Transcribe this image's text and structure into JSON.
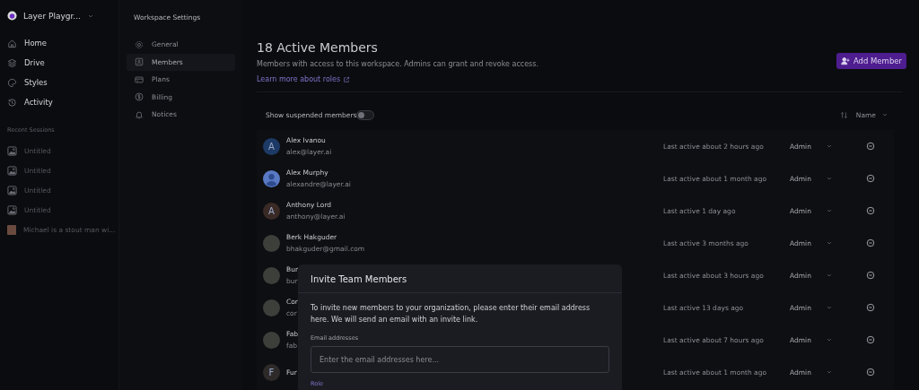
{
  "workspace": {
    "name": "Layer Playgr..."
  },
  "nav": [
    {
      "label": "Home"
    },
    {
      "label": "Drive"
    },
    {
      "label": "Styles"
    },
    {
      "label": "Activity"
    }
  ],
  "recent_sessions": {
    "title": "Recent Sessions",
    "items": [
      {
        "title": "Untitled",
        "kind": "blank"
      },
      {
        "title": "Untitled",
        "kind": "blank"
      },
      {
        "title": "Untitled",
        "kind": "blank"
      },
      {
        "title": "Untitled",
        "kind": "blank"
      },
      {
        "title": "Michael is a stout man wi...",
        "kind": "photo"
      }
    ]
  },
  "settings": {
    "title": "Workspace Settings",
    "items": [
      {
        "label": "General",
        "selected": false
      },
      {
        "label": "Members",
        "selected": true
      },
      {
        "label": "Plans",
        "selected": false
      },
      {
        "label": "Billing",
        "selected": false
      },
      {
        "label": "Notices",
        "selected": false
      }
    ]
  },
  "members": {
    "title": "18 Active Members",
    "description": "Members with access to this workspace.  Admins can grant and revoke access.",
    "link": "Learn more about roles",
    "add_button": "Add Member",
    "show_suspended": {
      "label": "Show suspended members",
      "on": false
    },
    "sort": {
      "label": "Name"
    },
    "rows": [
      {
        "name": "Alex Ivanou",
        "email": "alex@layer.ai",
        "last_active": "Last active about 2 hours ago",
        "role": "Admin",
        "avatar": {
          "kind": "letter",
          "letter": "A",
          "color": "#1d3a66"
        }
      },
      {
        "name": "Alex Murphy",
        "email": "alexandre@layer.ai",
        "last_active": "Last active about 1 month ago",
        "role": "Admin",
        "avatar": {
          "kind": "silhouette"
        }
      },
      {
        "name": "Anthony Lord",
        "email": "anthony@layer.ai",
        "last_active": "Last active 1 day ago",
        "role": "Admin",
        "avatar": {
          "kind": "letter",
          "letter": "A",
          "color": "#3a2a26"
        }
      },
      {
        "name": "Berk Hakguder",
        "email": "bhakguder@gmail.com",
        "last_active": "Last active 3 months ago",
        "role": "Admin",
        "avatar": {
          "kind": "photo"
        }
      },
      {
        "name": "Bur",
        "email": "bur",
        "last_active": "Last active about 3 hours ago",
        "role": "Admin",
        "avatar": {
          "kind": "photo"
        }
      },
      {
        "name": "Cor",
        "email": "cor",
        "last_active": "Last active 13 days ago",
        "role": "Admin",
        "avatar": {
          "kind": "photo"
        }
      },
      {
        "name": "Fab",
        "email": "fab",
        "last_active": "Last active about 7 hours ago",
        "role": "Admin",
        "avatar": {
          "kind": "photo"
        }
      },
      {
        "name": "Fur",
        "last_active": "Last active about 1 month ago",
        "role": "Admin",
        "avatar": {
          "kind": "letter",
          "letter": "F",
          "color": "#2e2a2a"
        }
      }
    ]
  },
  "modal": {
    "title": "Invite Team Members",
    "text": "To invite new members to your organization, please enter their email address here. We will send an email with an invite link.",
    "email_label": "Email addresses",
    "email_placeholder": "Enter the email addresses here...",
    "role_label": "Role"
  }
}
